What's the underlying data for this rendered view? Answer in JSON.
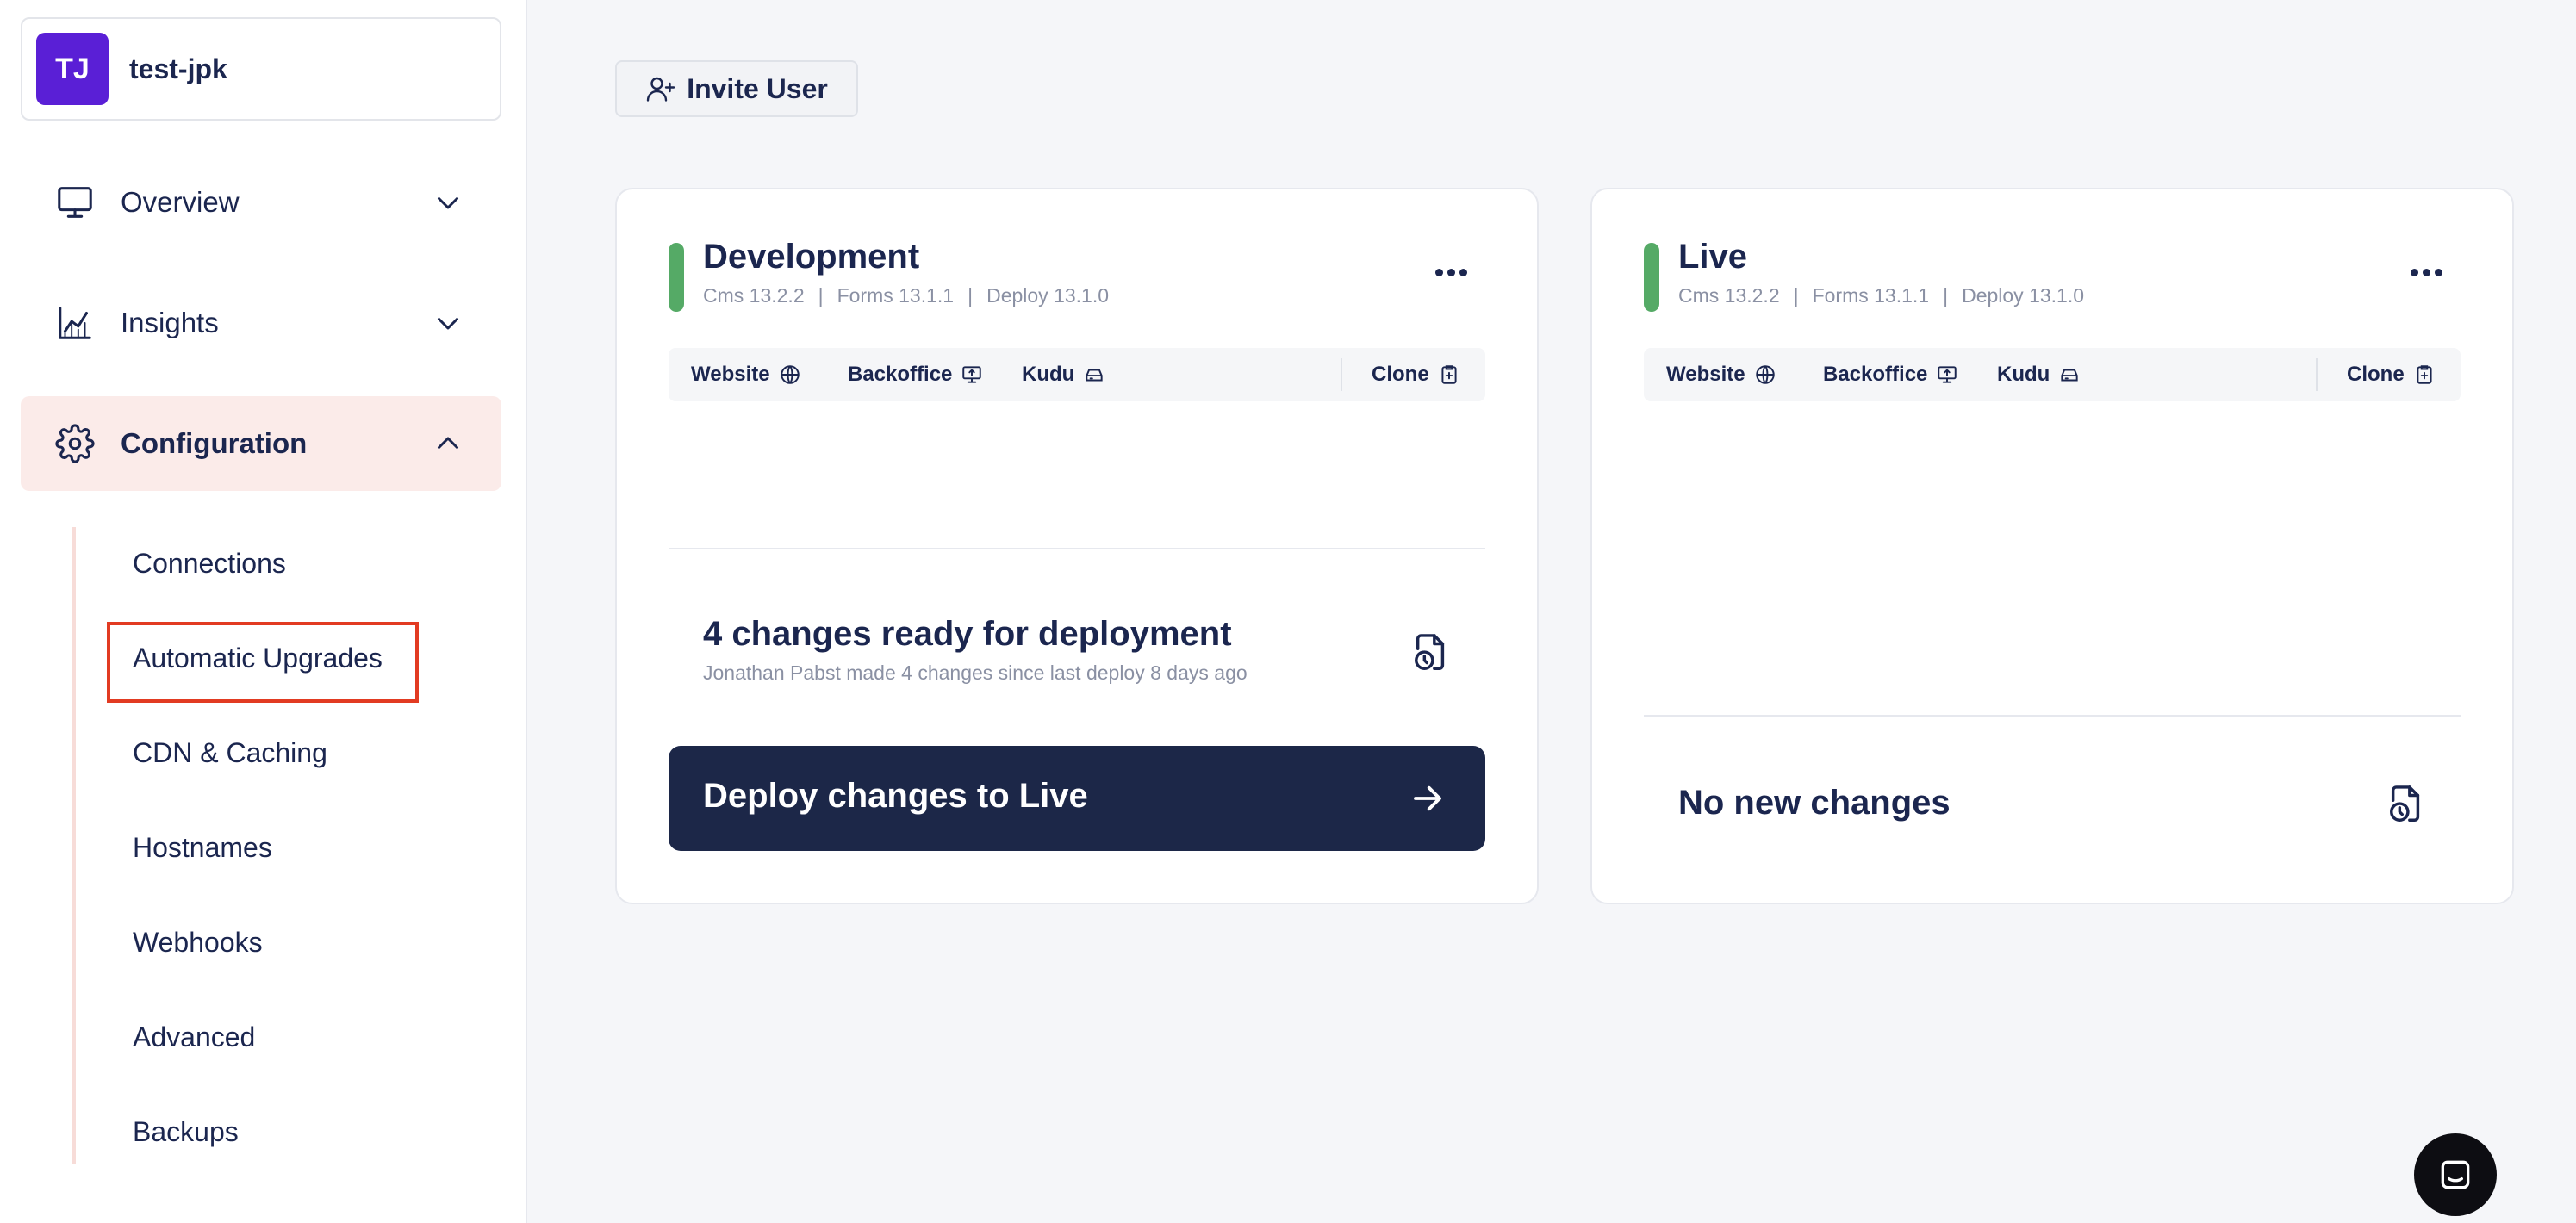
{
  "project": {
    "initials": "TJ",
    "name": "test-jpk"
  },
  "nav": {
    "overview": "Overview",
    "insights": "Insights",
    "configuration": "Configuration"
  },
  "subnav": [
    "Connections",
    "Automatic Upgrades",
    "CDN & Caching",
    "Hostnames",
    "Webhooks",
    "Advanced",
    "Backups"
  ],
  "invite_label": "Invite User",
  "environments": [
    {
      "title": "Development",
      "versions": [
        "Cms 13.2.2",
        "Forms 13.1.1",
        "Deploy 13.1.0"
      ],
      "status_color": "#55aa66",
      "toolbar": {
        "website": "Website",
        "backoffice": "Backoffice",
        "kudu": "Kudu",
        "clone": "Clone"
      },
      "changes_title": "4 changes ready for deployment",
      "changes_subtitle": "Jonathan Pabst made 4 changes since last deploy 8 days ago",
      "deploy_label": "Deploy changes to Live"
    },
    {
      "title": "Live",
      "versions": [
        "Cms 13.2.2",
        "Forms 13.1.1",
        "Deploy 13.1.0"
      ],
      "status_color": "#55aa66",
      "toolbar": {
        "website": "Website",
        "backoffice": "Backoffice",
        "kudu": "Kudu",
        "clone": "Clone"
      },
      "no_changes": "No new changes"
    }
  ],
  "colors": {
    "accent": "#5a1fd6",
    "active_bg": "#fbebe9",
    "deploy_bg": "#1c2748",
    "highlight": "#e23b22"
  }
}
